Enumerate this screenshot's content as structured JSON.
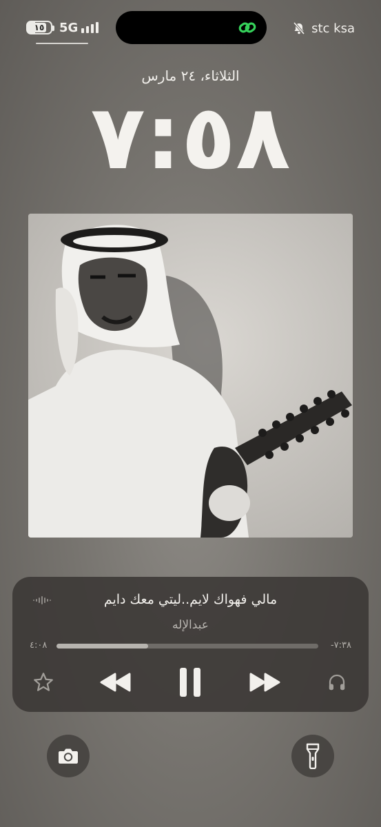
{
  "status_bar": {
    "battery_level": "١٥",
    "network": "5G",
    "carrier": "stc ksa",
    "silent_mode": true,
    "focus_link_color": "#35d15a"
  },
  "lock_screen": {
    "date": "الثلاثاء، ٢٤ مارس",
    "time": "٧:٥٨"
  },
  "now_playing": {
    "artwork_icon": "album-artwork",
    "title": "مالي فهواك لايم..ليتي معك دايم",
    "artist": "عبدالإله",
    "elapsed": "٤:٠٨",
    "remaining": "-٧:٣٨",
    "progress_fraction": 0.35,
    "controls": {
      "favorite_icon": "star-icon",
      "rewind_icon": "backward-icon",
      "pause_icon": "pause-icon",
      "forward_icon": "forward-icon",
      "output_icon": "headphones-icon"
    }
  },
  "shortcuts": {
    "left": "camera-icon",
    "right": "flashlight-icon"
  }
}
